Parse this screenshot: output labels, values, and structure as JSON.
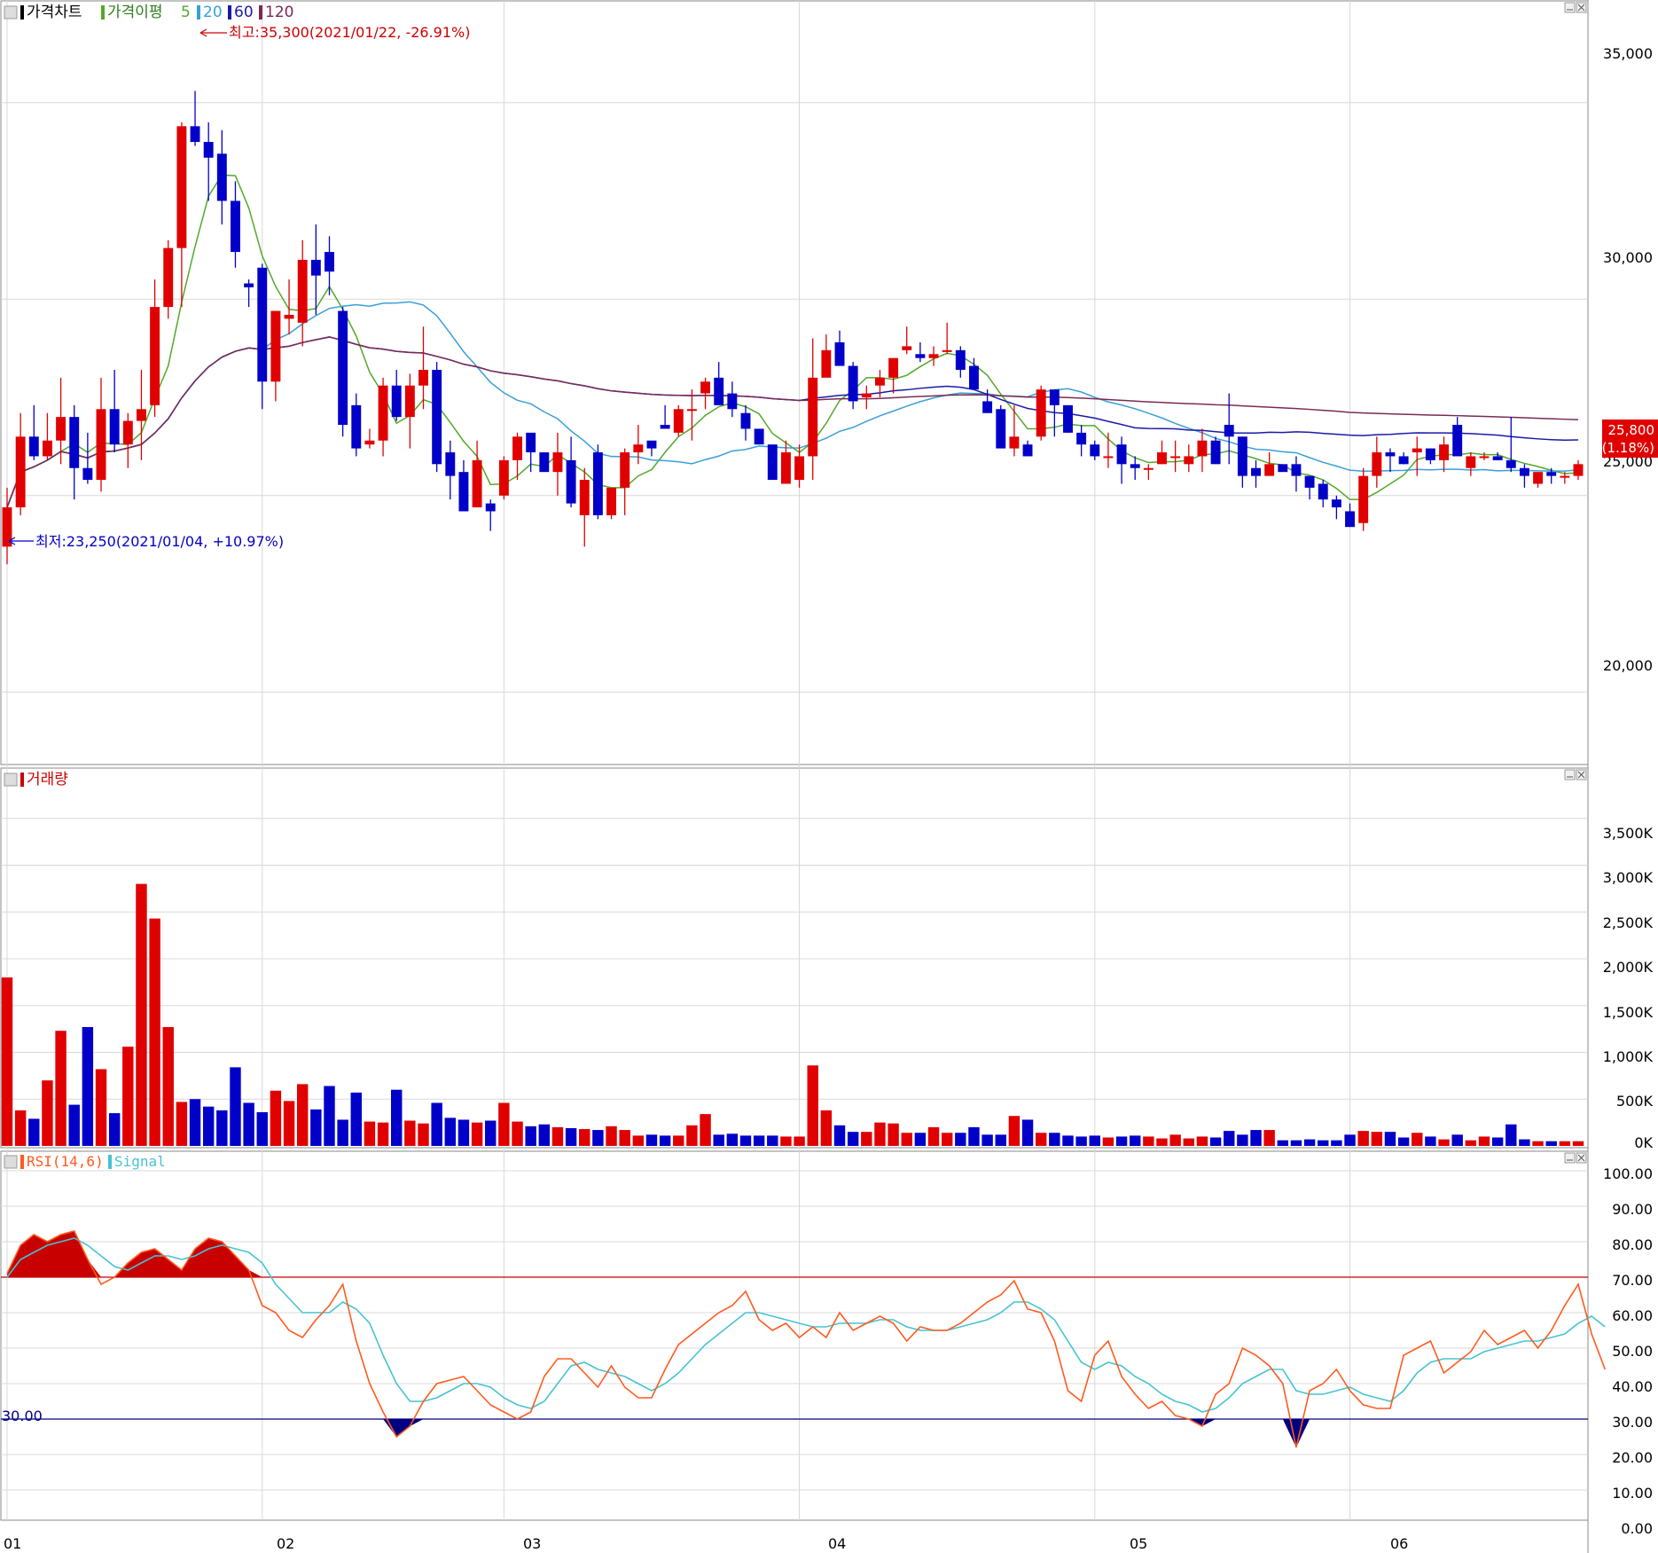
{
  "panels": {
    "price": {
      "legend": [
        {
          "text": "가격차트",
          "color": "#000000"
        },
        {
          "text": "가격이평",
          "color": "#2e7d1a"
        },
        {
          "text": "5",
          "color": "#52a82a"
        },
        {
          "text": "20",
          "color": "#3a9fd8"
        },
        {
          "text": "60",
          "color": "#1a1aa8"
        },
        {
          "text": "120",
          "color": "#7a2a55"
        }
      ],
      "annotations": {
        "high": "최고:35,300(2021/01/22, -26.91%)",
        "low": "최저:23,250(2021/01/04, +10.97%)"
      },
      "y_ticks": [
        "35,000",
        "30,000",
        "25,000",
        "20,000"
      ],
      "last_price": {
        "price": "25,800",
        "change": "(1.18%)"
      }
    },
    "volume": {
      "legend": [
        {
          "text": "거래량",
          "color": "#cc0000"
        }
      ],
      "y_ticks": [
        "3,500K",
        "3,000K",
        "2,500K",
        "2,000K",
        "1,500K",
        "1,000K",
        "500K",
        "0K"
      ]
    },
    "rsi": {
      "legend": [
        {
          "text": "RSI(14,6)",
          "color": "#ff5a1e"
        },
        {
          "text": "Signal",
          "color": "#46c3d2"
        }
      ],
      "y_ticks": [
        "100.00",
        "90.00",
        "80.00",
        "70.00",
        "60.00",
        "50.00",
        "40.00",
        "30.00",
        "20.00",
        "10.00",
        "0.00"
      ],
      "level_label": "30.00"
    }
  },
  "x_ticks": [
    "01",
    "02",
    "03",
    "04",
    "05",
    "06"
  ],
  "colors": {
    "up": "#e00000",
    "down": "#0000c8",
    "grid": "#d8d8d8",
    "ma5": "#52a82a",
    "ma20": "#3a9fd8",
    "ma60": "#1a1aa8",
    "ma120": "#7a2a55",
    "rsi": "#ff5a1e",
    "signal": "#46c3d2",
    "overbought": "#c80000",
    "oversold": "#000080"
  },
  "chart_data": {
    "type": "candlestick",
    "period": "2021/01 - 2021/06",
    "x_month_start_index": [
      0,
      19,
      37,
      59,
      81,
      100
    ],
    "candles": [
      [
        23700,
        25200,
        23250,
        24700
      ],
      [
        24700,
        27100,
        24500,
        26500
      ],
      [
        26500,
        27300,
        25900,
        26000
      ],
      [
        26000,
        27100,
        25900,
        26400
      ],
      [
        26400,
        28000,
        25800,
        27000
      ],
      [
        27000,
        27300,
        24900,
        25700
      ],
      [
        25700,
        26600,
        25300,
        25400
      ],
      [
        25400,
        28000,
        25100,
        27200
      ],
      [
        27200,
        28200,
        26100,
        26300
      ],
      [
        26300,
        27100,
        25700,
        26900
      ],
      [
        26900,
        28200,
        25900,
        27200
      ],
      [
        27300,
        30500,
        27000,
        29800
      ],
      [
        29800,
        31500,
        29500,
        31300
      ],
      [
        31300,
        34500,
        29800,
        34400
      ],
      [
        34400,
        35300,
        33900,
        34000
      ],
      [
        34000,
        34500,
        32500,
        33600
      ],
      [
        33700,
        34300,
        31900,
        32500
      ],
      [
        32500,
        33000,
        30800,
        31200
      ],
      [
        30400,
        30500,
        29800,
        30300
      ],
      [
        30800,
        30900,
        27200,
        27900
      ],
      [
        27900,
        29500,
        27400,
        29700
      ],
      [
        29500,
        30500,
        29100,
        29600
      ],
      [
        29400,
        31500,
        28800,
        31000
      ],
      [
        31000,
        31900,
        29600,
        30600
      ],
      [
        31200,
        31600,
        30100,
        30700
      ],
      [
        29700,
        29800,
        26500,
        26800
      ],
      [
        27300,
        27600,
        26000,
        26200
      ],
      [
        26300,
        26700,
        26200,
        26400
      ],
      [
        26400,
        28000,
        26000,
        27800
      ],
      [
        27800,
        28200,
        26900,
        27000
      ],
      [
        27000,
        28100,
        26200,
        27800
      ],
      [
        27800,
        29300,
        27200,
        28200
      ],
      [
        28200,
        28400,
        25600,
        25800
      ],
      [
        26100,
        26400,
        24900,
        25500
      ],
      [
        25600,
        25900,
        24600,
        24600
      ],
      [
        24700,
        26400,
        24800,
        25900
      ],
      [
        24800,
        24900,
        24100,
        24600
      ],
      [
        25000,
        26000,
        24900,
        25900
      ],
      [
        25900,
        26600,
        25400,
        26500
      ],
      [
        26600,
        26300,
        25600,
        26100
      ],
      [
        26100,
        26000,
        25700,
        25600
      ],
      [
        25600,
        26600,
        25000,
        26100
      ],
      [
        25900,
        26500,
        24700,
        24800
      ],
      [
        24500,
        25700,
        23700,
        25400
      ],
      [
        26100,
        26300,
        24400,
        24500
      ],
      [
        24500,
        25200,
        24400,
        25200
      ],
      [
        25200,
        26200,
        24500,
        26100
      ],
      [
        26100,
        26800,
        25800,
        26300
      ],
      [
        26400,
        26300,
        26000,
        26200
      ],
      [
        26800,
        27300,
        26700,
        26700
      ],
      [
        26600,
        27300,
        26500,
        27200
      ],
      [
        27200,
        27700,
        26400,
        27200
      ],
      [
        27600,
        28000,
        27200,
        27900
      ],
      [
        28000,
        28400,
        27300,
        27300
      ],
      [
        27600,
        27900,
        27000,
        27200
      ],
      [
        27100,
        27300,
        26400,
        26700
      ],
      [
        26700,
        26700,
        26300,
        26300
      ],
      [
        26300,
        26200,
        25400,
        25400
      ],
      [
        25300,
        26400,
        25400,
        26100
      ],
      [
        25400,
        26300,
        25200,
        26000
      ],
      [
        26000,
        29000,
        25400,
        28000
      ],
      [
        28000,
        29100,
        28200,
        28700
      ],
      [
        28900,
        29200,
        28300,
        28300
      ],
      [
        28300,
        28400,
        27200,
        27400
      ],
      [
        27500,
        27800,
        27200,
        27600
      ],
      [
        27800,
        28200,
        27500,
        28000
      ],
      [
        28000,
        28500,
        27600,
        28500
      ],
      [
        28700,
        29300,
        28600,
        28800
      ],
      [
        28600,
        28900,
        28400,
        28500
      ],
      [
        28500,
        28800,
        28300,
        28600
      ],
      [
        28700,
        29400,
        28600,
        28700
      ],
      [
        28700,
        28800,
        28000,
        28200
      ],
      [
        28300,
        28500,
        27700,
        27700
      ],
      [
        27400,
        27700,
        27100,
        27100
      ],
      [
        27200,
        27300,
        26300,
        26200
      ],
      [
        26200,
        27300,
        26000,
        26500
      ],
      [
        26300,
        26400,
        26000,
        26000
      ],
      [
        26500,
        27800,
        26400,
        27700
      ],
      [
        27700,
        27700,
        26500,
        27300
      ],
      [
        27300,
        27300,
        26600,
        26600
      ],
      [
        26600,
        26800,
        26000,
        26300
      ],
      [
        26300,
        26400,
        25900,
        26000
      ],
      [
        26000,
        26600,
        25700,
        26000
      ],
      [
        26300,
        26500,
        25300,
        25800
      ],
      [
        25800,
        26000,
        25400,
        25700
      ],
      [
        25700,
        25800,
        25400,
        25700
      ],
      [
        25800,
        26400,
        25800,
        26100
      ],
      [
        26000,
        26400,
        25600,
        26000
      ],
      [
        25800,
        26300,
        25600,
        26000
      ],
      [
        26000,
        26700,
        25600,
        26400
      ],
      [
        26400,
        26500,
        25800,
        25800
      ],
      [
        26800,
        27600,
        25800,
        26500
      ],
      [
        26500,
        26500,
        25200,
        25500
      ],
      [
        25700,
        25900,
        25200,
        25500
      ],
      [
        25500,
        26100,
        25500,
        25800
      ],
      [
        25800,
        25600,
        25600,
        25600
      ],
      [
        25800,
        26000,
        25100,
        25500
      ],
      [
        25500,
        25400,
        24900,
        25200
      ],
      [
        25300,
        25400,
        24700,
        24900
      ],
      [
        24900,
        25000,
        24400,
        24700
      ],
      [
        24600,
        24800,
        24300,
        24200
      ],
      [
        24300,
        25700,
        24100,
        25500
      ],
      [
        25500,
        26500,
        25200,
        26100
      ],
      [
        26100,
        26200,
        25600,
        26000
      ],
      [
        26000,
        26100,
        25800,
        25800
      ],
      [
        26100,
        26500,
        25500,
        26200
      ],
      [
        26200,
        26200,
        25800,
        25900
      ],
      [
        25900,
        26500,
        25600,
        26300
      ],
      [
        26800,
        27000,
        26000,
        26000
      ],
      [
        25700,
        26100,
        25500,
        26000
      ],
      [
        26000,
        26100,
        25900,
        26000
      ],
      [
        26000,
        26100,
        25900,
        25900
      ],
      [
        25900,
        27000,
        25600,
        25700
      ],
      [
        25700,
        25800,
        25200,
        25500
      ],
      [
        25300,
        25600,
        25200,
        25600
      ],
      [
        25600,
        25700,
        25300,
        25500
      ],
      [
        25500,
        25600,
        25300,
        25500
      ],
      [
        25500,
        25900,
        25400,
        25800
      ]
    ],
    "volume_k": [
      1800,
      380,
      290,
      700,
      1230,
      440,
      1270,
      820,
      350,
      1060,
      2800,
      2430,
      1270,
      470,
      500,
      420,
      380,
      840,
      460,
      360,
      590,
      480,
      660,
      390,
      640,
      280,
      570,
      260,
      250,
      600,
      270,
      240,
      460,
      300,
      280,
      250,
      270,
      460,
      260,
      210,
      230,
      200,
      190,
      180,
      170,
      210,
      170,
      110,
      120,
      110,
      110,
      220,
      340,
      120,
      130,
      110,
      110,
      110,
      100,
      100,
      860,
      380,
      220,
      150,
      150,
      250,
      240,
      140,
      140,
      200,
      140,
      140,
      200,
      120,
      120,
      320,
      280,
      140,
      140,
      110,
      100,
      110,
      90,
      100,
      110,
      100,
      80,
      120,
      80,
      100,
      90,
      160,
      120,
      170,
      170,
      60,
      60,
      70,
      60,
      60,
      120,
      160,
      150,
      150,
      90,
      140,
      100,
      70,
      120,
      60,
      100,
      90,
      230,
      70,
      50,
      50,
      50,
      50
    ],
    "ma_periods": [
      5,
      20,
      60,
      120
    ],
    "rsi": [
      71,
      79,
      82,
      80,
      82,
      83,
      75,
      68,
      70,
      74,
      77,
      78,
      75,
      72,
      78,
      81,
      80,
      76,
      72,
      62,
      60,
      55,
      53,
      58,
      62,
      68,
      52,
      40,
      32,
      25,
      28,
      35,
      40,
      41,
      42,
      38,
      34,
      32,
      30,
      32,
      42,
      47,
      47,
      43,
      39,
      45,
      39,
      36,
      36,
      44,
      51,
      54,
      57,
      60,
      62,
      66,
      58,
      55,
      57,
      53,
      56,
      53,
      60,
      55,
      57,
      59,
      57,
      52,
      56,
      55,
      55,
      57,
      60,
      63,
      65,
      69,
      61,
      60,
      52,
      38,
      35,
      48,
      52,
      42,
      37,
      33,
      35,
      31,
      30,
      28,
      37,
      40,
      50,
      48,
      45,
      40,
      22,
      38,
      40,
      44,
      38,
      34,
      33,
      33,
      48,
      50,
      52,
      43,
      46,
      49,
      55,
      51,
      53,
      55,
      50,
      55,
      62,
      68,
      54,
      44
    ],
    "rsi_signal": [
      70,
      75,
      77,
      79,
      80,
      81,
      79,
      76,
      73,
      72,
      74,
      76,
      76,
      75,
      76,
      78,
      79,
      78,
      77,
      74,
      68,
      64,
      60,
      60,
      60,
      63,
      61,
      57,
      48,
      40,
      35,
      35,
      36,
      38,
      40,
      40,
      39,
      36,
      34,
      33,
      35,
      40,
      45,
      46,
      44,
      43,
      42,
      40,
      38,
      40,
      43,
      47,
      51,
      54,
      57,
      60,
      60,
      59,
      58,
      57,
      56,
      56,
      57,
      57,
      57,
      58,
      58,
      56,
      55,
      55,
      55,
      56,
      57,
      58,
      60,
      63,
      63,
      61,
      58,
      52,
      46,
      44,
      46,
      45,
      42,
      40,
      37,
      35,
      34,
      32,
      33,
      36,
      40,
      42,
      44,
      44,
      38,
      37,
      37,
      38,
      39,
      37,
      36,
      35,
      38,
      43,
      46,
      47,
      47,
      47,
      49,
      50,
      51,
      52,
      52,
      53,
      54,
      57,
      59,
      56
    ],
    "rsi_levels": [
      70,
      30
    ],
    "y_price_range": [
      18200,
      36800
    ],
    "y_volume_range_k": [
      0,
      4000
    ],
    "y_rsi_range": [
      0,
      100
    ]
  }
}
